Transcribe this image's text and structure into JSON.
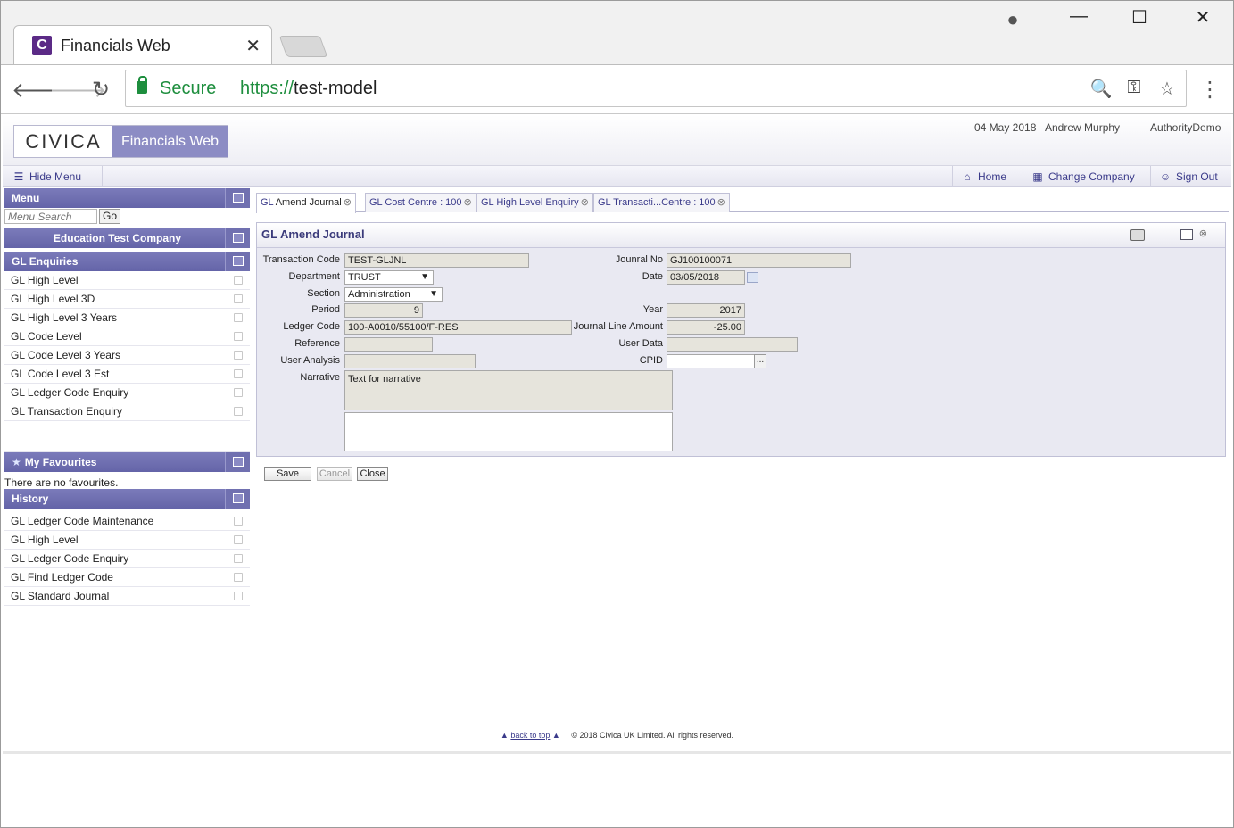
{
  "browser": {
    "tab_title": "Financials Web",
    "tab_favicon": "C",
    "tab_close": "✕",
    "secure_label": "Secure",
    "url_scheme": "https://",
    "url_host": "test-model"
  },
  "icons": {
    "back": "🡐",
    "forward": "🡒",
    "reload": "↻",
    "zoom": "🔍",
    "key": "⚿",
    "star": "☆",
    "menu": "⋮",
    "profile": "●",
    "minimize": "—",
    "maximize": "☐",
    "close": "✕"
  },
  "header": {
    "logo_civica": "CIVICA",
    "logo_product": "Financials Web",
    "date": "04 May 2018",
    "user": "Andrew Murphy",
    "authority": "AuthorityDemo"
  },
  "toolbar": {
    "hide_menu": "Hide Menu",
    "home": "Home",
    "change_company": "Change Company",
    "sign_out": "Sign Out"
  },
  "sidebar": {
    "menu_title": "Menu",
    "search_placeholder": "Menu Search",
    "go_label": "Go",
    "company": "Education Test Company",
    "enquiries_title": "GL Enquiries",
    "enquiries": [
      "GL High Level",
      "GL High Level 3D",
      "GL High Level 3 Years",
      "GL Code Level",
      "GL Code Level 3 Years",
      "GL Code Level 3 Est",
      "GL Ledger Code Enquiry",
      "GL Transaction Enquiry"
    ],
    "favourites_title": "My Favourites",
    "no_favourites": "There are no favourites.",
    "history_title": "History",
    "history": [
      "GL Ledger Code Maintenance",
      "GL High Level",
      "GL Ledger Code Enquiry",
      "GL Find Ledger Code",
      "GL Standard Journal"
    ]
  },
  "content_tabs": [
    {
      "prefix": "GL",
      "label": "Amend Journal"
    },
    {
      "prefix": "GL",
      "label": "Cost Centre : 100"
    },
    {
      "prefix": "GL",
      "label": "High Level Enquiry"
    },
    {
      "prefix": "GL",
      "label": "Transacti...Centre : 100"
    }
  ],
  "form": {
    "title": "GL Amend Journal",
    "labels": {
      "transaction_code": "Transaction Code",
      "department": "Department",
      "section": "Section",
      "period": "Period",
      "ledger_code": "Ledger Code",
      "reference": "Reference",
      "user_analysis": "User Analysis",
      "narrative": "Narrative",
      "journal_no": "Jounral No",
      "date": "Date",
      "year": "Year",
      "journal_line_amount": "Journal Line Amount",
      "user_data": "User Data",
      "cpid": "CPID"
    },
    "values": {
      "transaction_code": "TEST-GLJNL",
      "department": "TRUST",
      "section": "Administration",
      "period": "9",
      "ledger_code": "100-A0010/55100/F-RES",
      "reference": "",
      "user_analysis": "",
      "narrative": "Text for narrative",
      "narrative2": "",
      "journal_no": "GJ100100071",
      "date": "03/05/2018",
      "year": "2017",
      "journal_line_amount": "-25.00",
      "user_data": "",
      "cpid": "",
      "cpid_button": "..."
    },
    "buttons": {
      "save": "Save",
      "cancel": "Cancel",
      "close": "Close"
    }
  },
  "footer": {
    "back_to_top": "back to top",
    "copyright": "© 2018 Civica UK Limited. All rights reserved."
  }
}
